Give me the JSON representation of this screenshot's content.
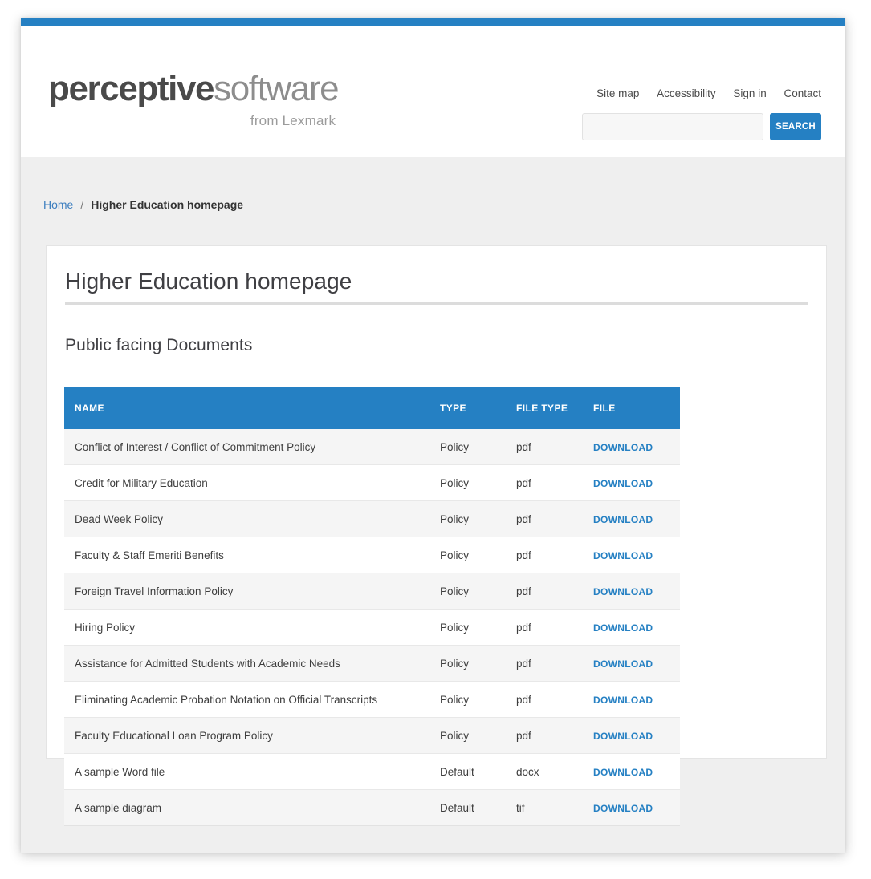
{
  "theme": {
    "accent_blue": "#2580c3",
    "link_blue": "#3c7ebf",
    "page_background": "#efefef",
    "row_stripe": "#f5f5f5"
  },
  "header": {
    "logo": {
      "bold_part": "perceptive",
      "light_part": "software",
      "tagline": "from Lexmark"
    },
    "util_nav": [
      {
        "label": "Site map"
      },
      {
        "label": "Accessibility"
      },
      {
        "label": "Sign in"
      },
      {
        "label": "Contact"
      }
    ],
    "search": {
      "value": "",
      "placeholder": "",
      "button_label": "SEARCH"
    }
  },
  "breadcrumb": {
    "home_label": "Home",
    "separator": "/",
    "current_label": "Higher Education homepage"
  },
  "main": {
    "page_title": "Higher Education homepage",
    "section_heading": "Public facing Documents",
    "table": {
      "columns": [
        "NAME",
        "TYPE",
        "FILE TYPE",
        "FILE"
      ],
      "download_label": "DOWNLOAD",
      "rows": [
        {
          "name": "Conflict of Interest / Conflict of Commitment Policy",
          "type": "Policy",
          "file_type": "pdf",
          "file": "DOWNLOAD"
        },
        {
          "name": "Credit for Military Education",
          "type": "Policy",
          "file_type": "pdf",
          "file": "DOWNLOAD"
        },
        {
          "name": "Dead Week Policy",
          "type": "Policy",
          "file_type": "pdf",
          "file": "DOWNLOAD"
        },
        {
          "name": "Faculty & Staff Emeriti Benefits",
          "type": "Policy",
          "file_type": "pdf",
          "file": "DOWNLOAD"
        },
        {
          "name": "Foreign Travel Information Policy",
          "type": "Policy",
          "file_type": "pdf",
          "file": "DOWNLOAD"
        },
        {
          "name": "Hiring Policy",
          "type": "Policy",
          "file_type": "pdf",
          "file": "DOWNLOAD"
        },
        {
          "name": "Assistance for Admitted Students with Academic Needs",
          "type": "Policy",
          "file_type": "pdf",
          "file": "DOWNLOAD"
        },
        {
          "name": "Eliminating Academic Probation Notation on Official Transcripts",
          "type": "Policy",
          "file_type": "pdf",
          "file": "DOWNLOAD"
        },
        {
          "name": "Faculty Educational Loan Program Policy",
          "type": "Policy",
          "file_type": "pdf",
          "file": "DOWNLOAD"
        },
        {
          "name": "A sample Word file",
          "type": "Default",
          "file_type": "docx",
          "file": "DOWNLOAD"
        },
        {
          "name": "A sample diagram",
          "type": "Default",
          "file_type": "tif",
          "file": "DOWNLOAD"
        }
      ]
    }
  }
}
